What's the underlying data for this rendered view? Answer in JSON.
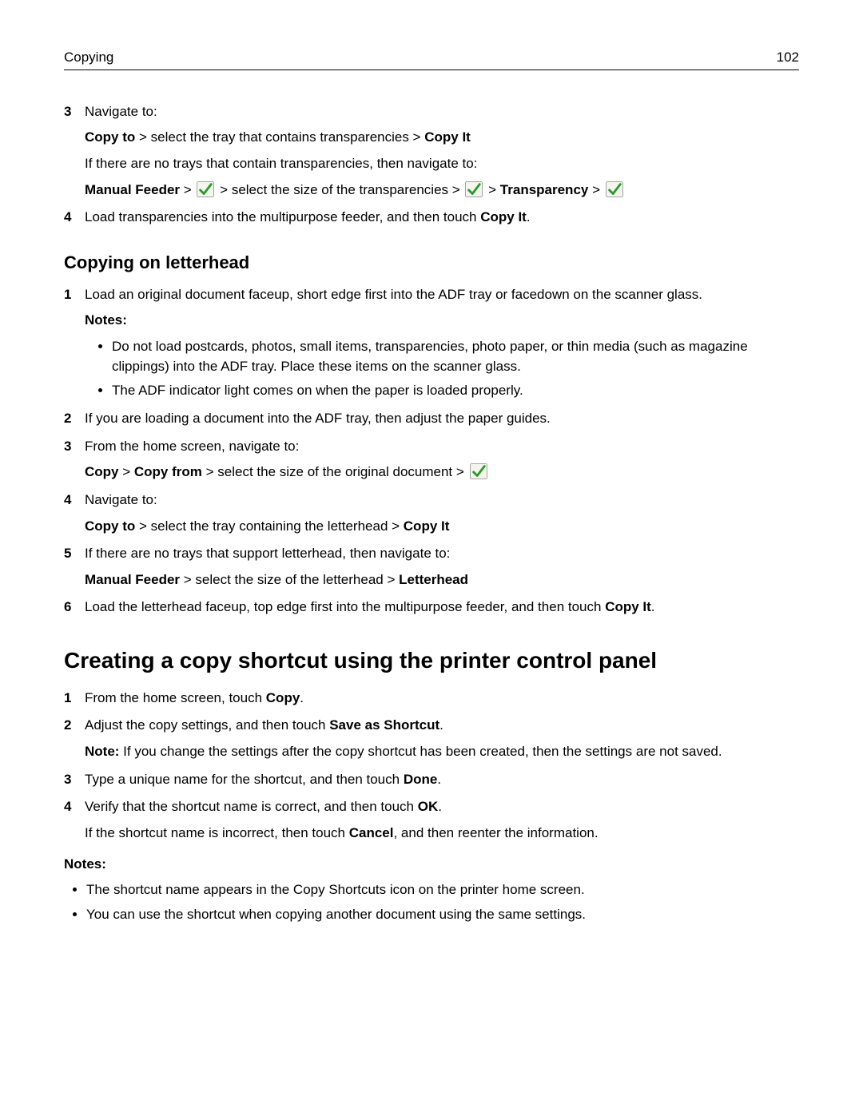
{
  "header": {
    "section": "Copying",
    "page": "102"
  },
  "top": {
    "step3": {
      "num": "3",
      "lead": "Navigate to:",
      "path_a": "Copy to",
      "path_b": " > select the tray that contains transparencies > ",
      "path_c": "Copy It",
      "none": "If there are no trays that contain transparencies, then navigate to:",
      "mf": "Manual Feeder",
      "mf_mid": " > select the size of the transparencies > ",
      "mf_end": "Transparency"
    },
    "step4": {
      "num": "4",
      "text_a": "Load transparencies into the multipurpose feeder, and then touch ",
      "text_b": "Copy It",
      "text_c": "."
    }
  },
  "letterhead": {
    "title": "Copying on letterhead",
    "s1": {
      "num": "1",
      "text": "Load an original document faceup, short edge first into the ADF tray or facedown on the scanner glass."
    },
    "notes_label": "Notes:",
    "note1": "Do not load postcards, photos, small items, transparencies, photo paper, or thin media (such as magazine clippings) into the ADF tray. Place these items on the scanner glass.",
    "note2": "The ADF indicator light comes on when the paper is loaded properly.",
    "s2": {
      "num": "2",
      "text": "If you are loading a document into the ADF tray, then adjust the paper guides."
    },
    "s3": {
      "num": "3",
      "text": "From the home screen, navigate to:",
      "p_a": "Copy",
      "p_b": "Copy from",
      "p_c": " > select the size of the original document > "
    },
    "s4": {
      "num": "4",
      "text": "Navigate to:",
      "p_a": "Copy to",
      "p_b": " > select the tray containing the letterhead > ",
      "p_c": "Copy It"
    },
    "s5": {
      "num": "5",
      "text": "If there are no trays that support letterhead, then navigate to:",
      "p_a": "Manual Feeder",
      "p_b": " > select the size of the letterhead > ",
      "p_c": "Letterhead"
    },
    "s6": {
      "num": "6",
      "t_a": "Load the letterhead faceup, top edge first into the multipurpose feeder, and then touch ",
      "t_b": "Copy It",
      "t_c": "."
    }
  },
  "shortcut": {
    "title": "Creating a copy shortcut using the printer control panel",
    "s1": {
      "num": "1",
      "a": "From the home screen, touch ",
      "b": "Copy",
      "c": "."
    },
    "s2": {
      "num": "2",
      "a": "Adjust the copy settings, and then touch ",
      "b": "Save as Shortcut",
      "c": ".",
      "note_lbl": "Note:",
      "note": " If you change the settings after the copy shortcut has been created, then the settings are not saved."
    },
    "s3": {
      "num": "3",
      "a": "Type a unique name for the shortcut, and then touch ",
      "b": "Done",
      "c": "."
    },
    "s4": {
      "num": "4",
      "a": "Verify that the shortcut name is correct, and then touch ",
      "b": "OK",
      "c": ".",
      "d": "If the shortcut name is incorrect, then touch ",
      "e": "Cancel",
      "f": ", and then reenter the information."
    },
    "notes_label": "Notes:",
    "n1": "The shortcut name appears in the Copy Shortcuts icon on the printer home screen.",
    "n2": "You can use the shortcut when copying another document using the same settings."
  }
}
